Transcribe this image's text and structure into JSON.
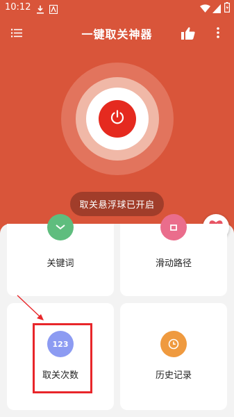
{
  "status_bar": {
    "time": "10:12"
  },
  "app_bar": {
    "title": "一键取关神器"
  },
  "main": {
    "status_pill": "取关悬浮球已开启"
  },
  "cards": {
    "keyword": "关键词",
    "swipe_path": "滑动路径",
    "unfollow_count": "取关次数",
    "history": "历史记录",
    "count_icon_text": "123"
  },
  "colors": {
    "header": "#d9553a",
    "power_button": "#e52a1f",
    "highlight": "#e8262a"
  }
}
